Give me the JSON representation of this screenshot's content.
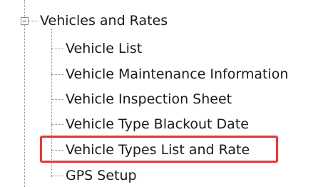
{
  "tree": {
    "parent": {
      "label": "Vehicles and Rates",
      "expanded": true,
      "expander_icon": "minus-box-icon"
    },
    "children": [
      {
        "label": "Vehicle List"
      },
      {
        "label": "Vehicle Maintenance Information"
      },
      {
        "label": "Vehicle Inspection Sheet"
      },
      {
        "label": "Vehicle Type Blackout Date"
      },
      {
        "label": "Vehicle Types List and Rate",
        "highlighted": true
      },
      {
        "label": "GPS Setup"
      }
    ]
  },
  "colors": {
    "highlight_border": "#e03a3a",
    "guide_lines": "#8c8c8c",
    "text": "#1a1a1a",
    "background": "#ffffff"
  }
}
